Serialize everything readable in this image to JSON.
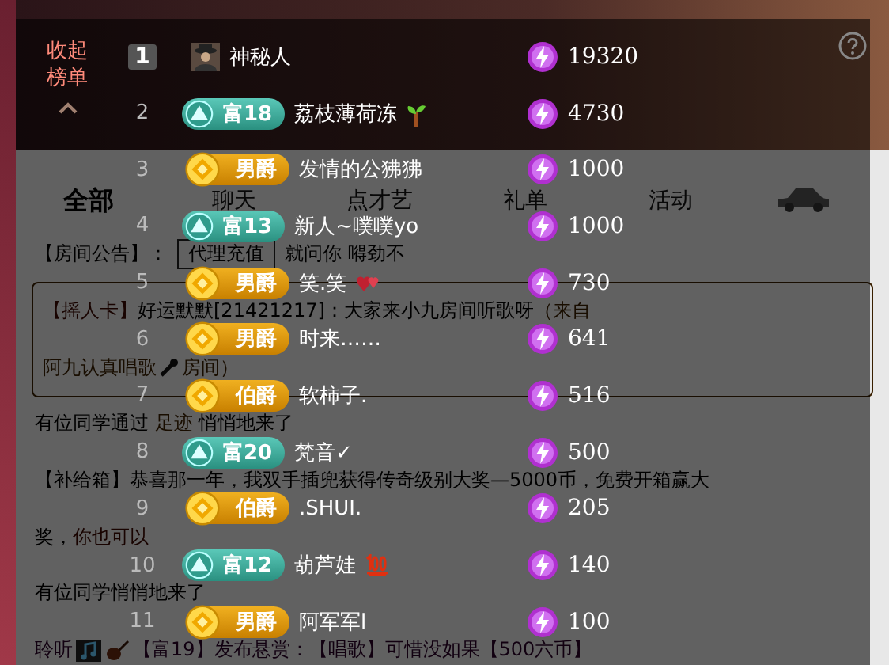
{
  "tabs": [
    {
      "label": "全部",
      "selected": true
    },
    {
      "label": "聊天",
      "selected": false
    },
    {
      "label": "点才艺",
      "selected": false
    },
    {
      "label": "礼单",
      "selected": false
    },
    {
      "label": "活动",
      "selected": false
    }
  ],
  "chat": [
    {
      "kind": "notice",
      "label": "【房间公告】：",
      "tag": "代理充值",
      "text": "就问你 嘚劲不"
    },
    {
      "kind": "card",
      "label": "【摇人卡】",
      "text": "好运默默[21421217]：大家来小九房间听歌呀",
      "source": "（来自",
      "source_end": "阿九认真唱歌",
      "room": "房间）"
    },
    {
      "kind": "visit",
      "text": "有位同学通过",
      "link": "足迹",
      "tail": "悄悄地来了"
    },
    {
      "kind": "box",
      "label": "【补给箱】",
      "text": "恭喜那一年，我双手插兜获得传奇级别大奖—5000币，免费开箱赢大",
      "text_end": "奖，",
      "link": "你也可以"
    },
    {
      "kind": "plain",
      "text": "有位同学悄悄地来了"
    },
    {
      "kind": "bounty",
      "label": "聆听",
      "text": "【富19】发布悬赏：【唱歌】可惜没如果【500六币】"
    }
  ],
  "ranking": {
    "collapse_label": "收起榜单",
    "rows": [
      {
        "rank": "1",
        "badge": {
          "kind": "mystery"
        },
        "name": "神秘人",
        "value": "19320",
        "highlighted": true
      },
      {
        "rank": "2",
        "badge": {
          "kind": "rich",
          "label": "富18"
        },
        "name": "荔枝薄荷冻",
        "decoration": {
          "kind": "sprout"
        },
        "value": "4730",
        "highlighted": false
      },
      {
        "rank": "3",
        "badge": {
          "kind": "noble",
          "label": "男爵"
        },
        "name": "发情的公狒狒",
        "value": "1000",
        "highlighted": false
      },
      {
        "rank": "4",
        "badge": {
          "kind": "rich",
          "label": "富13"
        },
        "name": "新人~噗噗yo",
        "value": "1000",
        "highlighted": false
      },
      {
        "rank": "5",
        "badge": {
          "kind": "noble",
          "label": "男爵"
        },
        "name": "笑.笑",
        "decoration": {
          "kind": "hearts"
        },
        "value": "730",
        "highlighted": false
      },
      {
        "rank": "6",
        "badge": {
          "kind": "noble",
          "label": "男爵"
        },
        "name": "时来……",
        "value": "641",
        "highlighted": false
      },
      {
        "rank": "7",
        "badge": {
          "kind": "noble",
          "label": "伯爵"
        },
        "name": "软柿子.",
        "value": "516",
        "highlighted": false
      },
      {
        "rank": "8",
        "badge": {
          "kind": "rich",
          "label": "富20"
        },
        "name": "梵音✓",
        "value": "500",
        "highlighted": false
      },
      {
        "rank": "9",
        "badge": {
          "kind": "noble",
          "label": "伯爵"
        },
        "name": ".SHUI.",
        "value": "205",
        "highlighted": false
      },
      {
        "rank": "10",
        "badge": {
          "kind": "rich",
          "label": "富12"
        },
        "name": "葫芦娃",
        "decoration": {
          "kind": "hundred"
        },
        "value": "140",
        "highlighted": false
      },
      {
        "rank": "11",
        "badge": {
          "kind": "noble",
          "label": "男爵"
        },
        "name": "阿军军l",
        "value": "100",
        "highlighted": false
      }
    ]
  }
}
